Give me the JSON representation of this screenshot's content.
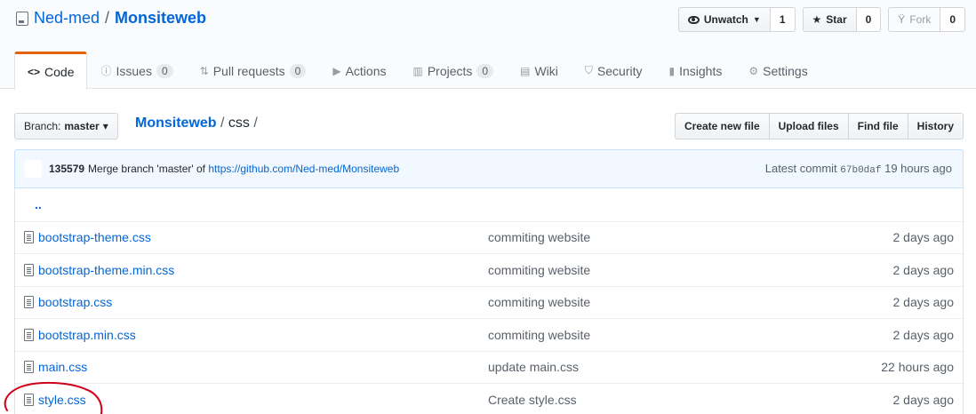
{
  "repo": {
    "owner": "Ned-med",
    "separator": "/",
    "name": "Monsiteweb"
  },
  "actions": [
    {
      "label": "Unwatch",
      "icon": "eye-icon",
      "count": "1"
    },
    {
      "label": "Star",
      "icon": "star-icon",
      "count": "0"
    },
    {
      "label": "Fork",
      "icon": "fork-icon",
      "count": "0"
    }
  ],
  "tabs": [
    {
      "icon": "<>",
      "label": "Code",
      "counter": null,
      "selected": true
    },
    {
      "icon": "ⓘ",
      "label": "Issues",
      "counter": "0"
    },
    {
      "icon": "⇅",
      "label": "Pull requests",
      "counter": "0"
    },
    {
      "icon": "▶",
      "label": "Actions",
      "counter": null
    },
    {
      "icon": "▥",
      "label": "Projects",
      "counter": "0"
    },
    {
      "icon": "▤",
      "label": "Wiki",
      "counter": null
    },
    {
      "icon": "⛉",
      "label": "Security",
      "counter": null
    },
    {
      "icon": "▮",
      "label": "Insights",
      "counter": null
    },
    {
      "icon": "⚙",
      "label": "Settings",
      "counter": null
    }
  ],
  "branch": {
    "prefix": "Branch:",
    "name": "master",
    "caret": "▾"
  },
  "breadcrumb": {
    "root": "Monsiteweb",
    "sep": " / ",
    "folder": "css",
    "trail": " /"
  },
  "file_nav": [
    "Create new file",
    "Upload files",
    "Find file",
    "History"
  ],
  "commit": {
    "author": "135579",
    "message": "Merge branch 'master' of ",
    "link": "https://github.com/Ned-med/Monsiteweb",
    "latest_label": "Latest commit ",
    "sha": "67b0daf",
    "age": " 19 hours ago"
  },
  "parent_dir": "..",
  "files": [
    {
      "name": "bootstrap-theme.css",
      "message": "commiting website",
      "age": "2 days ago"
    },
    {
      "name": "bootstrap-theme.min.css",
      "message": "commiting website",
      "age": "2 days ago"
    },
    {
      "name": "bootstrap.css",
      "message": "commiting website",
      "age": "2 days ago"
    },
    {
      "name": "bootstrap.min.css",
      "message": "commiting website",
      "age": "2 days ago"
    },
    {
      "name": "main.css",
      "message": "update main.css",
      "age": "22 hours ago"
    },
    {
      "name": "style.css",
      "message": "Create style.css",
      "age": "2 days ago"
    }
  ],
  "colors": {
    "link": "#0366d6",
    "tab_accent": "#e36209",
    "annotation": "#d0021b",
    "commit_bg": "#f1f8ff"
  }
}
